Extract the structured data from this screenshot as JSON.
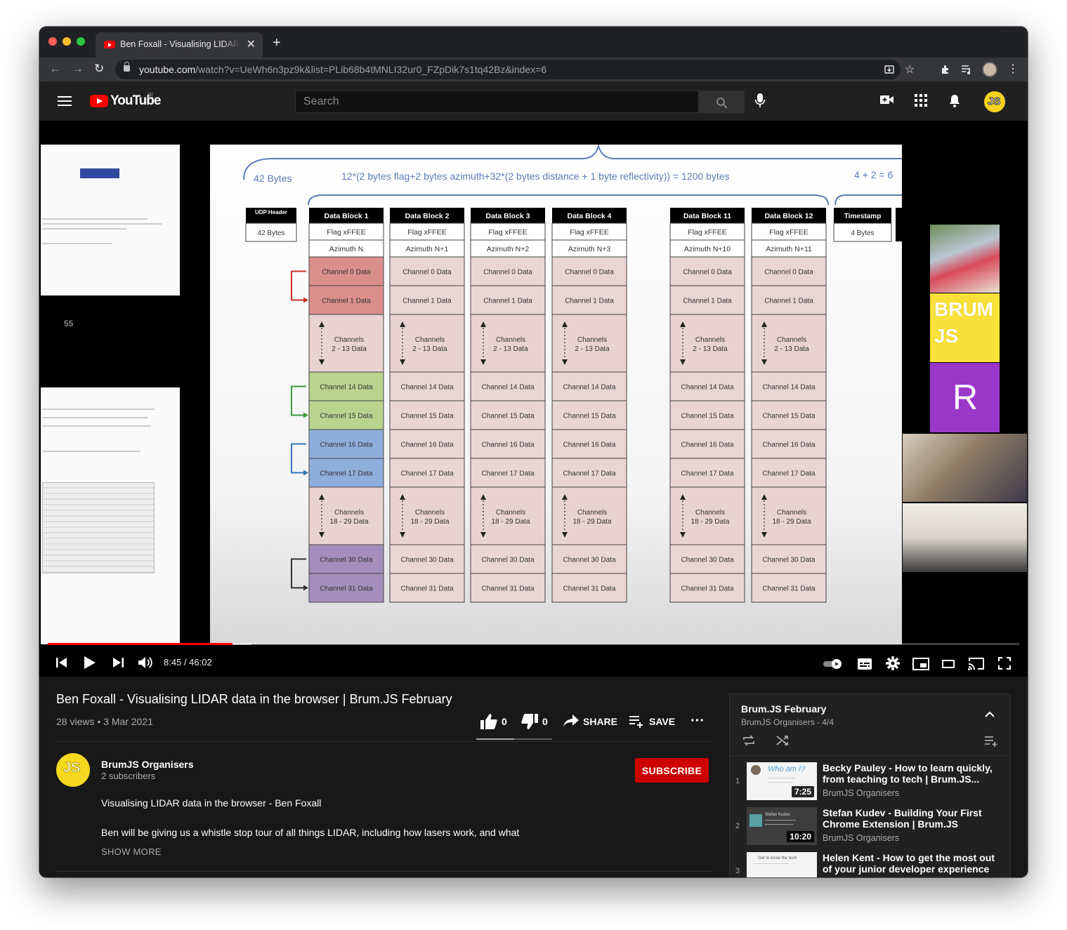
{
  "browser": {
    "tab_title": "Ben Foxall - Visualising LIDAR data in the browser | Brum.JS February",
    "url_host": "youtube.com",
    "url_path": "/watch?v=UeWh6n3pz9k&list=PLib68b4tMNLI32ur0_FZpDik7s1tq42Bz&index=6"
  },
  "youtube": {
    "logo_text": "YouTube",
    "country": "IE",
    "search_placeholder": "Search"
  },
  "slide": {
    "page_number": "55",
    "top_formula": "12*(2 bytes flag+2 bytes azimuth+32*(2 bytes distance + 1 byte reflectivity)) = 1200 bytes",
    "left_brace_label": "42 Bytes",
    "right_brace_label": "4 + 2 = 6",
    "udp_header": "UDP Header",
    "udp_bytes": "42 Bytes",
    "timestamp_label": "Timestamp",
    "timestamp_bytes": "4 Bytes",
    "blocks": [
      {
        "title": "Data Block 1",
        "flag": "Flag xFFEE",
        "azimuth": "Azimuth N"
      },
      {
        "title": "Data Block 2",
        "flag": "Flag xFFEE",
        "azimuth": "Azimuth N+1"
      },
      {
        "title": "Data Block 3",
        "flag": "Flag xFFEE",
        "azimuth": "Azimuth N+2"
      },
      {
        "title": "Data Block 4",
        "flag": "Flag xFFEE",
        "azimuth": "Azimuth N+3"
      },
      {
        "title": "Data Block 11",
        "flag": "Flag xFFEE",
        "azimuth": "Azimuth N+10"
      },
      {
        "title": "Data Block 12",
        "flag": "Flag xFFEE",
        "azimuth": "Azimuth N+11"
      }
    ],
    "rows": [
      {
        "label": "Channel 0 Data",
        "kind": "single"
      },
      {
        "label": "Channel 1 Data",
        "kind": "single"
      },
      {
        "label": "Channels 2 - 13 Data",
        "kind": "range"
      },
      {
        "label": "Channel 14 Data",
        "kind": "single"
      },
      {
        "label": "Channel 15 Data",
        "kind": "single"
      },
      {
        "label": "Channel 16 Data",
        "kind": "single"
      },
      {
        "label": "Channel 17 Data",
        "kind": "single"
      },
      {
        "label": "Channels 18 - 29 Data",
        "kind": "range"
      },
      {
        "label": "Channel 30 Data",
        "kind": "single"
      },
      {
        "label": "Channel 31 Data",
        "kind": "single"
      }
    ],
    "first_block_colors": [
      "#d98f8c",
      "#d98f8c",
      "#e9d2d2",
      "#b9d48e",
      "#b9d48e",
      "#8eaedb",
      "#8eaedb",
      "#e9d2d2",
      "#a58ebd",
      "#a58ebd"
    ],
    "bracket_colors": [
      "#c9302c",
      "#3a9a3e",
      "#3276b7",
      "#333333"
    ],
    "range_fill": "#e9d2d2",
    "cell_fill": "#ead5d5"
  },
  "gallery": {
    "brum_text": "BRUM JS",
    "r_initial": "R"
  },
  "player": {
    "current_time": "8:45",
    "duration": "46:02",
    "time_display": "8:45 / 46:02",
    "progress_fraction": 0.19
  },
  "video": {
    "title": "Ben Foxall - Visualising LIDAR data in the browser | Brum.JS February",
    "meta": "28 views • 3 Mar 2021",
    "likes": "0",
    "dislikes": "0",
    "share_label": "SHARE",
    "save_label": "SAVE",
    "channel_name": "BrumJS Organisers",
    "subscribers": "2 subscribers",
    "subscribe_label": "SUBSCRIBE",
    "desc_line1": "Visualising LIDAR data in the browser - Ben Foxall",
    "desc_line2": "Ben will be giving us a whistle stop tour of all things LIDAR, including how lasers work, and what",
    "show_more": "SHOW MORE"
  },
  "playlist": {
    "title": "Brum.JS February",
    "subtitle": "BrumJS Organisers - 4/4",
    "items": [
      {
        "index": "1",
        "title": "Becky Pauley - How to learn quickly, from teaching to tech | Brum.JS...",
        "channel": "BrumJS Organisers",
        "duration": "7:25"
      },
      {
        "index": "2",
        "title": "Stefan Kudev - Building Your First Chrome Extension | Brum.JS February",
        "channel": "BrumJS Organisers",
        "duration": "10:20"
      },
      {
        "index": "3",
        "title": "Helen Kent - How to get the most out of your junior developer experience |...",
        "channel": "",
        "duration": ""
      }
    ]
  }
}
